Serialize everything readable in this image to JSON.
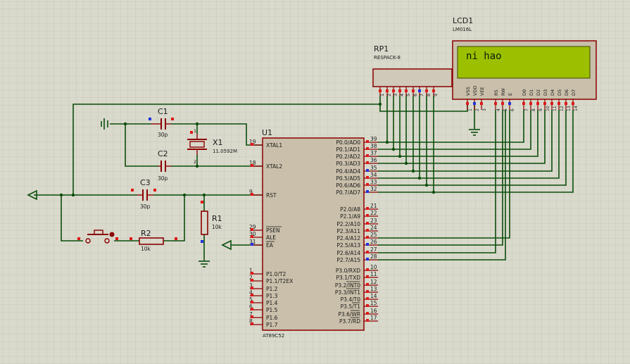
{
  "lcd": {
    "ref": "LCD1",
    "part": "LM016L",
    "display_text": "ni hao",
    "pins": [
      "VSS",
      "VDD",
      "VEE",
      "RS",
      "RW",
      "E",
      "D0",
      "D1",
      "D2",
      "D3",
      "D4",
      "D5",
      "D6",
      "D7"
    ],
    "pin_numbers": [
      "1",
      "2",
      "3",
      "4",
      "5",
      "6",
      "7",
      "8",
      "9",
      "10",
      "11",
      "12",
      "13",
      "14"
    ]
  },
  "rp1": {
    "ref": "RP1",
    "part": "RESPACK-8",
    "pin_numbers": [
      "1",
      "2",
      "3",
      "4",
      "5",
      "6",
      "7",
      "8",
      "9"
    ]
  },
  "u1": {
    "ref": "U1",
    "part": "AT89C52",
    "left_pins": [
      {
        "num": "19",
        "label": "XTAL1"
      },
      {
        "num": "18",
        "label": "XTAL2"
      },
      {
        "num": "9",
        "label": "RST"
      },
      {
        "num": "29",
        "label": "PSEN"
      },
      {
        "num": "30",
        "label": "ALE"
      },
      {
        "num": "31",
        "label": "EA"
      },
      {
        "num": "1",
        "label": "P1.0/T2"
      },
      {
        "num": "2",
        "label": "P1.1/T2EX"
      },
      {
        "num": "3",
        "label": "P1.2"
      },
      {
        "num": "4",
        "label": "P1.3"
      },
      {
        "num": "5",
        "label": "P1.4"
      },
      {
        "num": "6",
        "label": "P1.5"
      },
      {
        "num": "7",
        "label": "P1.6"
      },
      {
        "num": "8",
        "label": "P1.7"
      }
    ],
    "right_pins": [
      {
        "num": "39",
        "label": "P0.0/AD0"
      },
      {
        "num": "38",
        "label": "P0.1/AD1"
      },
      {
        "num": "37",
        "label": "P0.2/AD2"
      },
      {
        "num": "36",
        "label": "P0.3/AD3"
      },
      {
        "num": "35",
        "label": "P0.4/AD4"
      },
      {
        "num": "34",
        "label": "P0.5/AD5"
      },
      {
        "num": "33",
        "label": "P0.6/AD6"
      },
      {
        "num": "32",
        "label": "P0.7/AD7"
      },
      {
        "num": "21",
        "label": "P2.0/A8"
      },
      {
        "num": "22",
        "label": "P2.1/A9"
      },
      {
        "num": "23",
        "label": "P2.2/A10"
      },
      {
        "num": "24",
        "label": "P2.3/A11"
      },
      {
        "num": "25",
        "label": "P2.4/A12"
      },
      {
        "num": "26",
        "label": "P2.5/A13"
      },
      {
        "num": "27",
        "label": "P2.6/A14"
      },
      {
        "num": "28",
        "label": "P2.7/A15"
      },
      {
        "num": "10",
        "label": "P3.0/RXD"
      },
      {
        "num": "11",
        "label": "P3.1/TXD"
      },
      {
        "num": "12",
        "label": "P3.2/INT0"
      },
      {
        "num": "13",
        "label": "P3.3/INT1"
      },
      {
        "num": "14",
        "label": "P3.4/T0"
      },
      {
        "num": "15",
        "label": "P3.5/T1"
      },
      {
        "num": "16",
        "label": "P3.6/WR"
      },
      {
        "num": "17",
        "label": "P3.7/RD"
      }
    ]
  },
  "c1": {
    "ref": "C1",
    "value": "30p"
  },
  "c2": {
    "ref": "C2",
    "value": "30p"
  },
  "c3": {
    "ref": "C3",
    "value": "30p"
  },
  "x1": {
    "ref": "X1",
    "value": "11.0592M",
    "pin1": "1",
    "pin2": "2"
  },
  "r1": {
    "ref": "R1",
    "value": "10k"
  },
  "r2": {
    "ref": "R2",
    "value": "10k"
  },
  "colors": {
    "background": "#d9d9cc",
    "grid": "#c4c4b6",
    "wire": "#0b4d0b",
    "component": "#8b0000",
    "chip_fill": "#c9bfaa",
    "lcd_screen": "#9cbf00",
    "lcd_text": "#0a1e0a",
    "text": "#1a1a1a",
    "pin_red": "#e01818",
    "pin_blue": "#2032e0"
  }
}
